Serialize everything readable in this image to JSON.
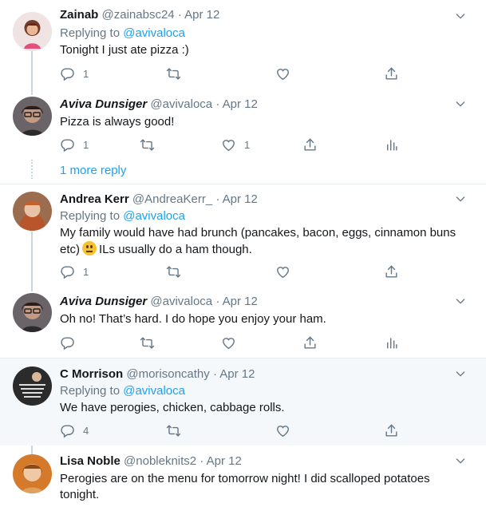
{
  "tweets": [
    {
      "name": "Zainab",
      "handle": "@zainabsc24",
      "date": "Apr 12",
      "replying_prefix": "Replying to ",
      "replying_to": "@avivaloca",
      "text": "Tonight I just ate pizza :)",
      "reply_count": "1",
      "retweet_count": "",
      "like_count": ""
    },
    {
      "name": "Aviva Dunsiger",
      "handle": "@avivaloca",
      "date": "Apr 12",
      "text": "Pizza is always good!",
      "reply_count": "1",
      "retweet_count": "",
      "like_count": "1"
    },
    {
      "name": "Andrea Kerr",
      "handle": "@AndreaKerr_",
      "date": "Apr 12",
      "replying_prefix": "Replying to ",
      "replying_to": "@avivaloca",
      "text_line1": "My family would have had brunch (pancakes, bacon, eggs, cinnamon buns",
      "text_line2_a": "etc)",
      "text_line2_b": "ILs usually do a ham though.",
      "reply_count": "1",
      "retweet_count": "",
      "like_count": ""
    },
    {
      "name": "Aviva Dunsiger",
      "handle": "@avivaloca",
      "date": "Apr 12",
      "text": "Oh no! That’s hard. I do hope you enjoy your ham.",
      "reply_count": "",
      "retweet_count": "",
      "like_count": ""
    },
    {
      "name": "C Morrison",
      "handle": "@morisoncathy",
      "date": "Apr 12",
      "replying_prefix": "Replying to ",
      "replying_to": "@avivaloca",
      "text": "We have perogies, chicken, cabbage rolls.",
      "reply_count": "4",
      "retweet_count": "",
      "like_count": ""
    },
    {
      "name": "Lisa Noble",
      "handle": "@nobleknits2",
      "date": "Apr 12",
      "text_line1": "Perogies are on the menu for tomorrow night! I did scalloped potatoes",
      "text_line2": "tonight."
    }
  ],
  "more_reply_link": "1 more reply",
  "separator": "·",
  "colors": {
    "accent": "#1da1f2",
    "muted": "#657786",
    "highlight_bg": "#f5f8fa"
  }
}
